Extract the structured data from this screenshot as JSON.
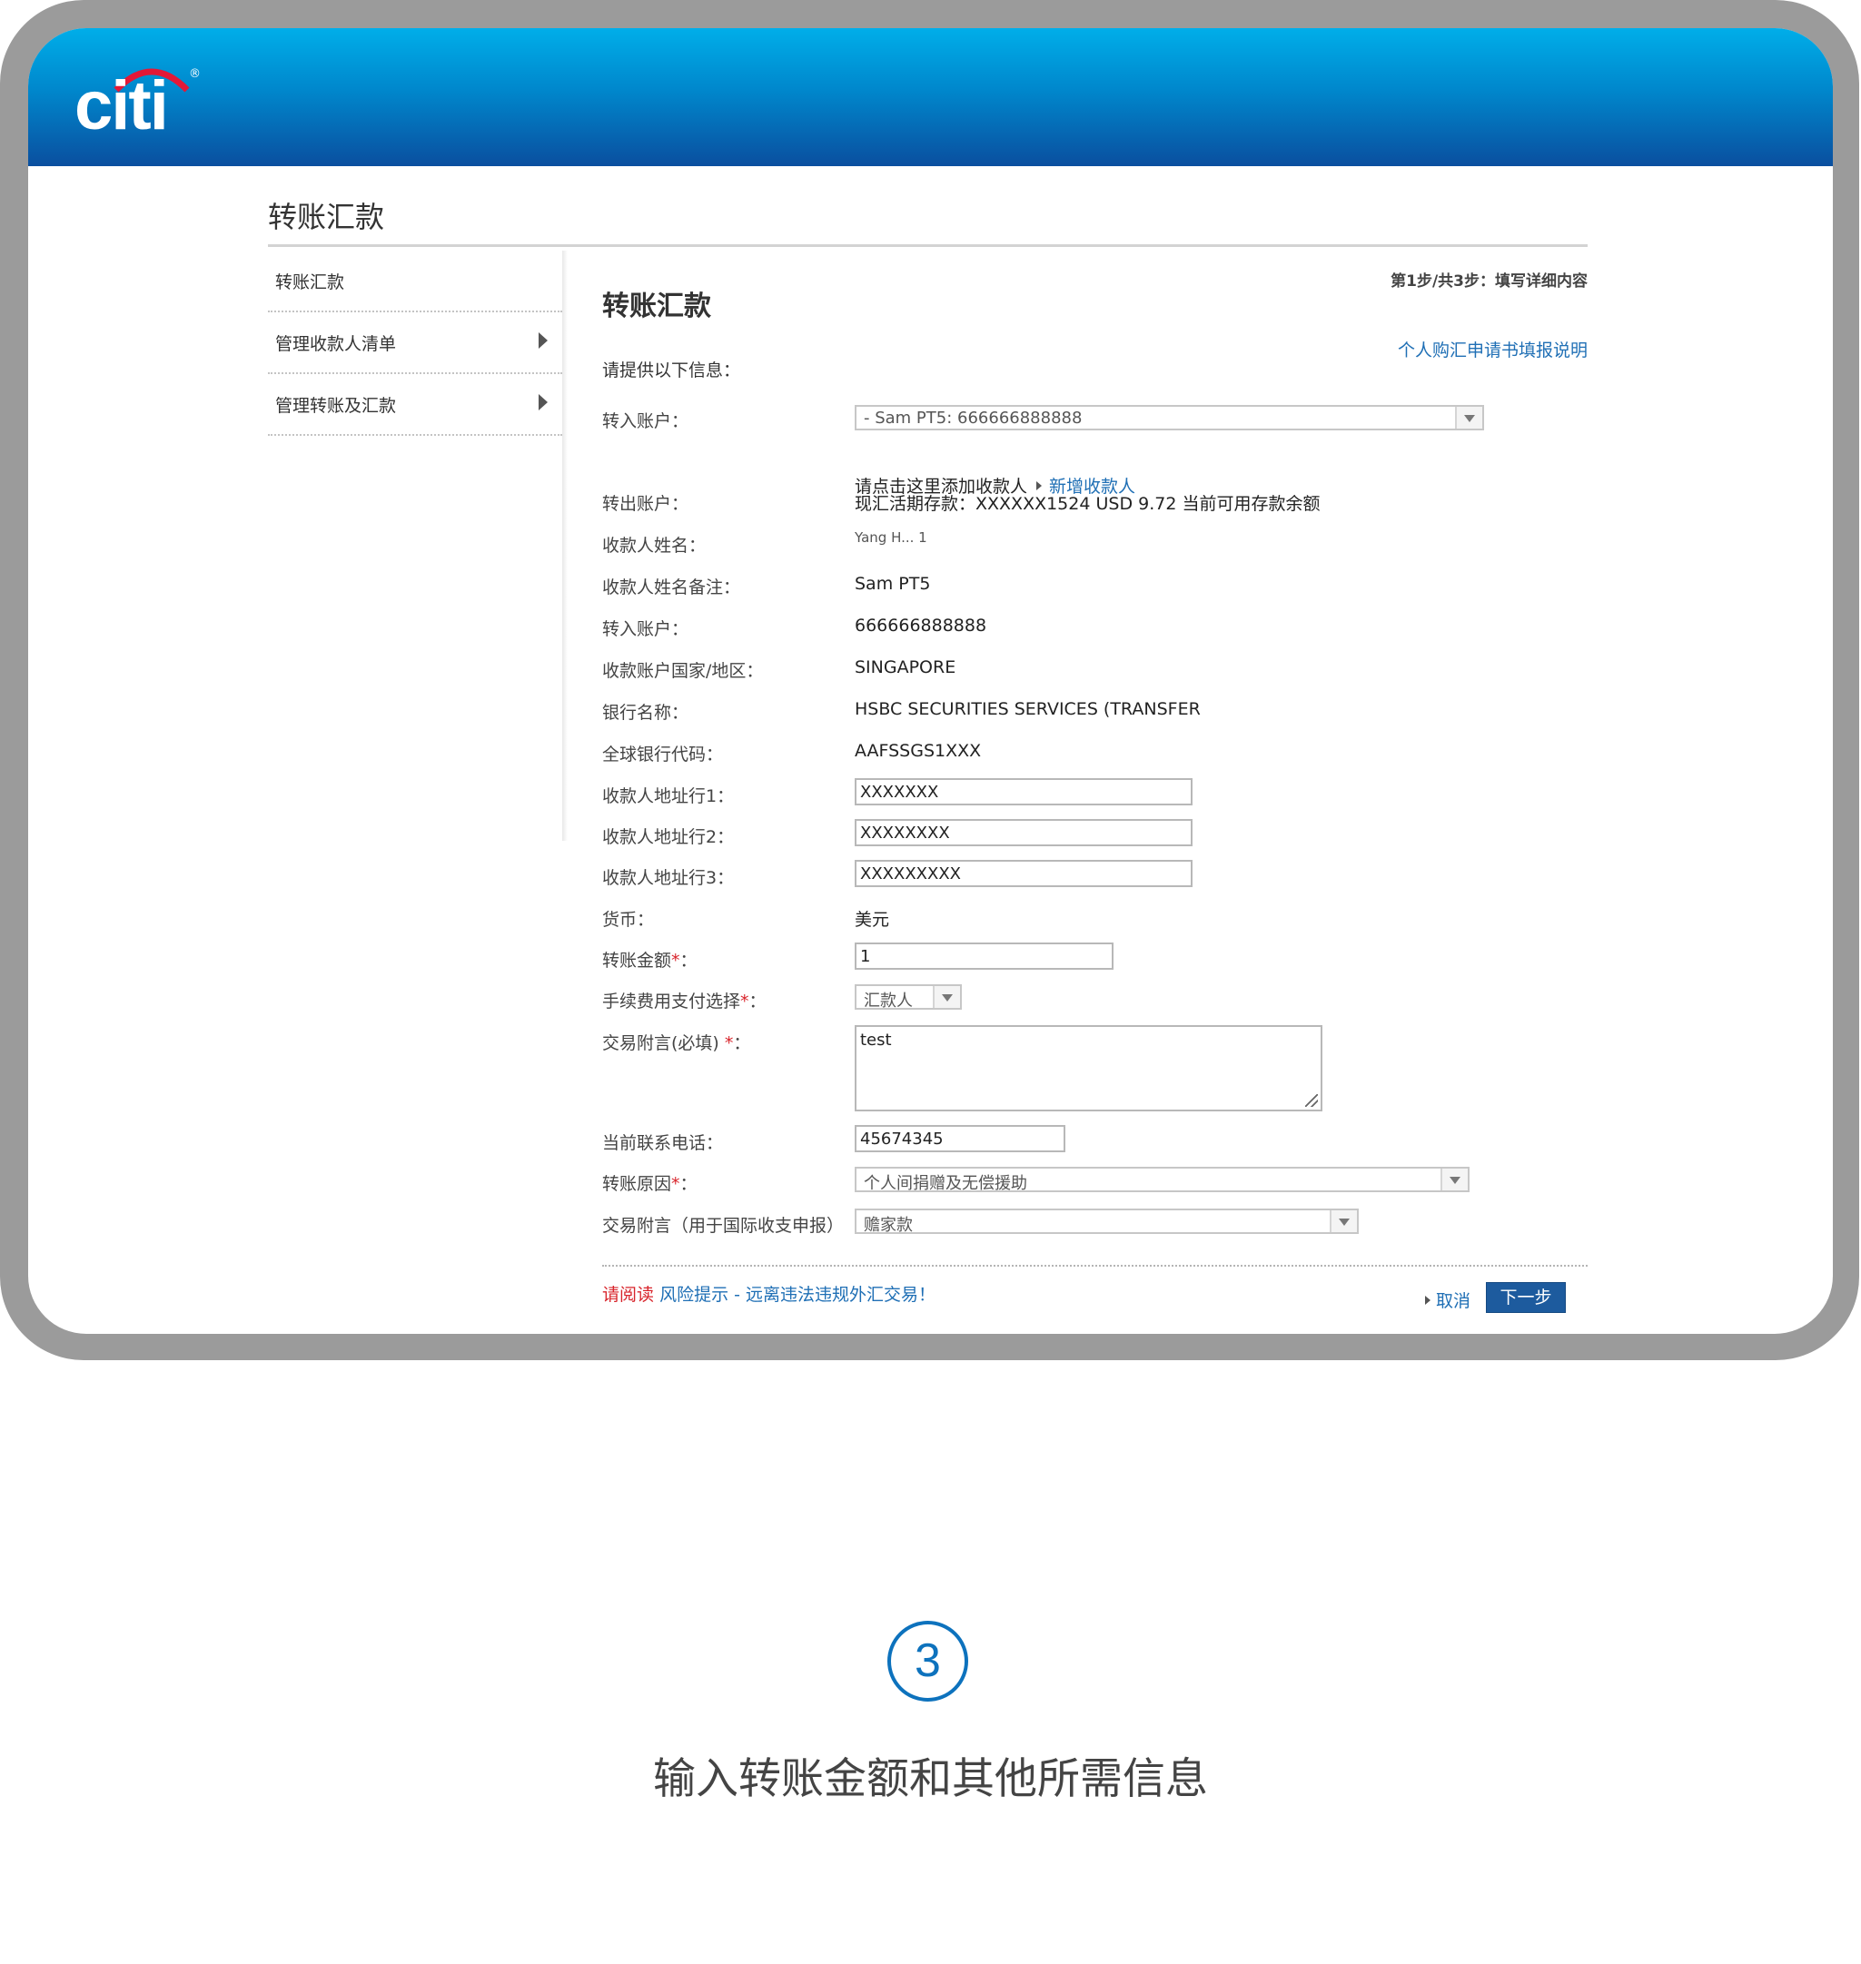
{
  "brand": {
    "logo_text": "citi",
    "logo_reg": "®"
  },
  "page_title": "转账汇款",
  "sidebar": {
    "items": [
      {
        "label": "转账汇款",
        "has_arrow": false
      },
      {
        "label": "管理收款人清单",
        "has_arrow": true
      },
      {
        "label": "管理转账及汇款",
        "has_arrow": true
      }
    ]
  },
  "main": {
    "title": "转账汇款",
    "step": "第1步/共3步：填写详细内容",
    "guide_link": "个人购汇申请书填报说明",
    "intro": "请提供以下信息："
  },
  "form": {
    "to_account_label": "转入账户：",
    "to_account_select": "- Sam PT5: 666666888888",
    "add_hint": "请点击这里添加收款人",
    "add_link": "新增收款人",
    "from_account_label": "转出账户：",
    "from_account_value": "现汇活期存款：XXXXXX1524 USD 9.72 当前可用存款余额",
    "payee_name_label": "收款人姓名：",
    "payee_name_value": "Yang H...   1",
    "payee_note_label": "收款人姓名备注：",
    "payee_note_value": "Sam PT5",
    "to_acct_no_label": "转入账户：",
    "to_acct_no_value": "666666888888",
    "country_label": "收款账户国家/地区：",
    "country_value": "SINGAPORE",
    "bank_name_label": "银行名称：",
    "bank_name_value": "HSBC SECURITIES SERVICES (TRANSFER",
    "swift_label": "全球银行代码：",
    "swift_value": "AAFSSGS1XXX",
    "addr1_label": "收款人地址行1：",
    "addr1_value": "XXXXXXX",
    "addr2_label": "收款人地址行2：",
    "addr2_value": "XXXXXXXX",
    "addr3_label": "收款人地址行3：",
    "addr3_value": "XXXXXXXXX",
    "currency_label": "货币：",
    "currency_value": "美元",
    "amount_label": "转账金额",
    "amount_value": "1",
    "fee_label": "手续费用支付选择",
    "fee_value": "汇款人",
    "memo_label": "交易附言(必填) ",
    "memo_value": "test",
    "phone_label": "当前联系电话：",
    "phone_value": "45674345",
    "reason_label": "转账原因",
    "reason_value": "个人间捐赠及无偿援助",
    "bop_label": "交易附言（用于国际收支申报）",
    "bop_value": "赡家款",
    "required_mark": "*",
    "colon": "："
  },
  "footer": {
    "risk_red": "请阅读",
    "risk_link": "风险提示 - 远离违法违规外汇交易！",
    "cancel": "取消",
    "next": "下一步"
  },
  "step_badge": "3",
  "caption": "输入转账金额和其他所需信息",
  "colors": {
    "brand_blue": "#0a4f9f",
    "link_blue": "#1f6fb5",
    "required_red": "#d8242b",
    "frame_grey": "#9b9b9b"
  }
}
